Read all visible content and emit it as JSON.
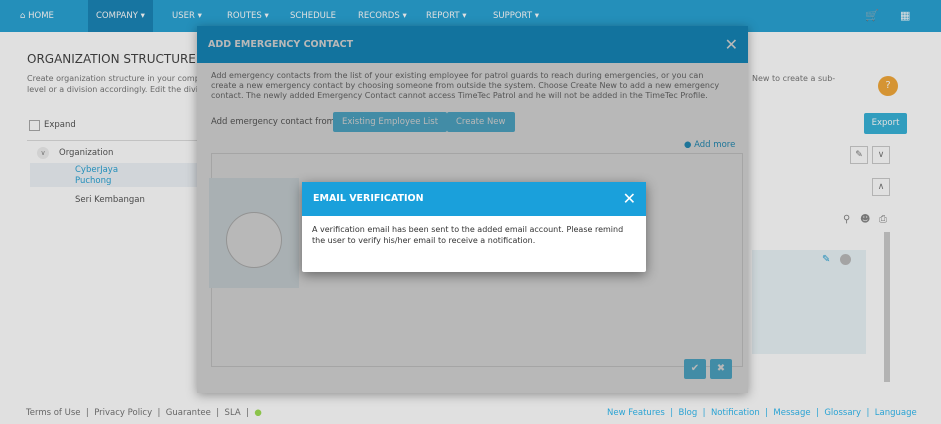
{
  "nav": {
    "items": [
      "HOME",
      "COMPANY",
      "USER",
      "ROUTES",
      "SCHEDULE",
      "RECORDS",
      "REPORT",
      "SUPPORT"
    ],
    "home_icon": "home-icon",
    "cart_icon": "cart-icon",
    "grid_icon": "grid-icon"
  },
  "org": {
    "title": "ORGANIZATION STRUCTURE",
    "desc1": "Create organization structure in your comp",
    "desc2": "level or a division accordingly. Edit the divi",
    "right_desc": "New to create a sub-",
    "expand": "Expand",
    "export": "Export",
    "tree_root": "Organization",
    "tree_items": [
      "CyberJaya",
      "Puchong",
      "Seri Kembangan"
    ]
  },
  "modal": {
    "title": "ADD EMERGENCY CONTACT",
    "desc": "Add emergency contacts from the list of your existing employee for patrol guards to reach during emergencies, or you can create a new emergency contact by choosing someone from outside the system. Choose Create New to add a new emergency contact. The newly added Emergency Contact cannot access TimeTec Patrol and he will not be added in the TimeTec Profile.",
    "from_label": "Add emergency contact from",
    "btn_existing": "Existing Employee List",
    "btn_create": "Create New",
    "add_more": "Add more"
  },
  "dialog": {
    "title": "EMAIL VERIFICATION",
    "message": "A verification email has been sent to the added email account. Please remind the user to verify his/her email to receive a notification."
  },
  "footer": {
    "left": [
      "Terms of Use",
      "Privacy Policy",
      "Guarantee",
      "SLA"
    ],
    "right": [
      "New Features",
      "Blog",
      "Notification",
      "Message",
      "Glossary",
      "Language"
    ]
  },
  "colors": {
    "primary": "#1aa0db",
    "nav": "#2aa3d4",
    "button": "#5cc3e6",
    "export": "#38b3d9"
  }
}
